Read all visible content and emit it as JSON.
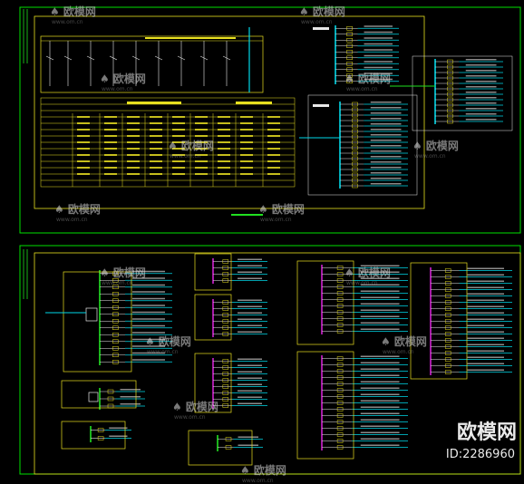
{
  "watermark": {
    "brand": "欧模网",
    "url": "www.om.cn",
    "badge_brand": "欧模网",
    "badge_id": "ID:2286960"
  },
  "colors": {
    "background": "#000000",
    "frame": "#00e000",
    "yellow": "#e8e020",
    "cyan": "#00d8e8",
    "magenta": "#d020d0",
    "white": "#e8e8e8",
    "green": "#20e020"
  }
}
